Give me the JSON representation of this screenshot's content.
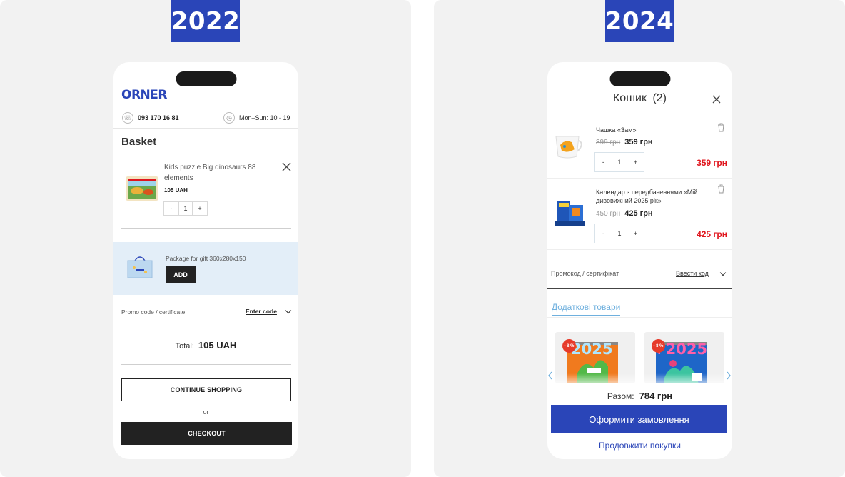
{
  "left": {
    "year": "2022",
    "logo": "ORNER",
    "phone_number": "093 170 16 81",
    "hours": "Mon–Sun: 10 - 19",
    "title": "Basket",
    "item": {
      "name": "Kids puzzle Big dinosaurs 88 elements",
      "price": "105 UAH",
      "qty": "1",
      "minus": "-",
      "plus": "+"
    },
    "gift": {
      "name": "Package for gift 360x280x150",
      "add_label": "ADD"
    },
    "promo": {
      "label": "Promo code / certificate",
      "link": "Enter code"
    },
    "total": {
      "label": "Total:",
      "value": "105 UAH"
    },
    "continue_label": "CONTINUE SHOPPING",
    "or_label": "or",
    "checkout_label": "CHECKOUT"
  },
  "right": {
    "year": "2024",
    "title": "Кошик",
    "count": "(2)",
    "items": [
      {
        "name": "Чашка «Зам»",
        "old_price": "399 грн",
        "price": "359 грн",
        "qty": "1",
        "total": "359 грн"
      },
      {
        "name": "Календар з передбаченнями «Мій дивовижний 2025 рік»",
        "old_price": "450 грн",
        "price": "425 грн",
        "qty": "1",
        "total": "425 грн"
      }
    ],
    "minus": "-",
    "plus": "+",
    "promo": {
      "label": "Промокод / сертифікат",
      "link": "Ввести код"
    },
    "tab": "Додаткові товари",
    "cards": [
      {
        "badge": "- 8 %",
        "year_text": "2025"
      },
      {
        "badge": "- 8 %",
        "year_text": "+2025"
      }
    ],
    "total": {
      "label": "Разом:",
      "value": "784 грн"
    },
    "checkout_label": "Оформити замовлення",
    "continue_label": "Продовжити покупки"
  },
  "colors": {
    "brand_blue": "#2a45b8",
    "sale_red": "#e0161e",
    "tab_blue": "#6fb0de",
    "gift_band": "#e3eef8"
  }
}
